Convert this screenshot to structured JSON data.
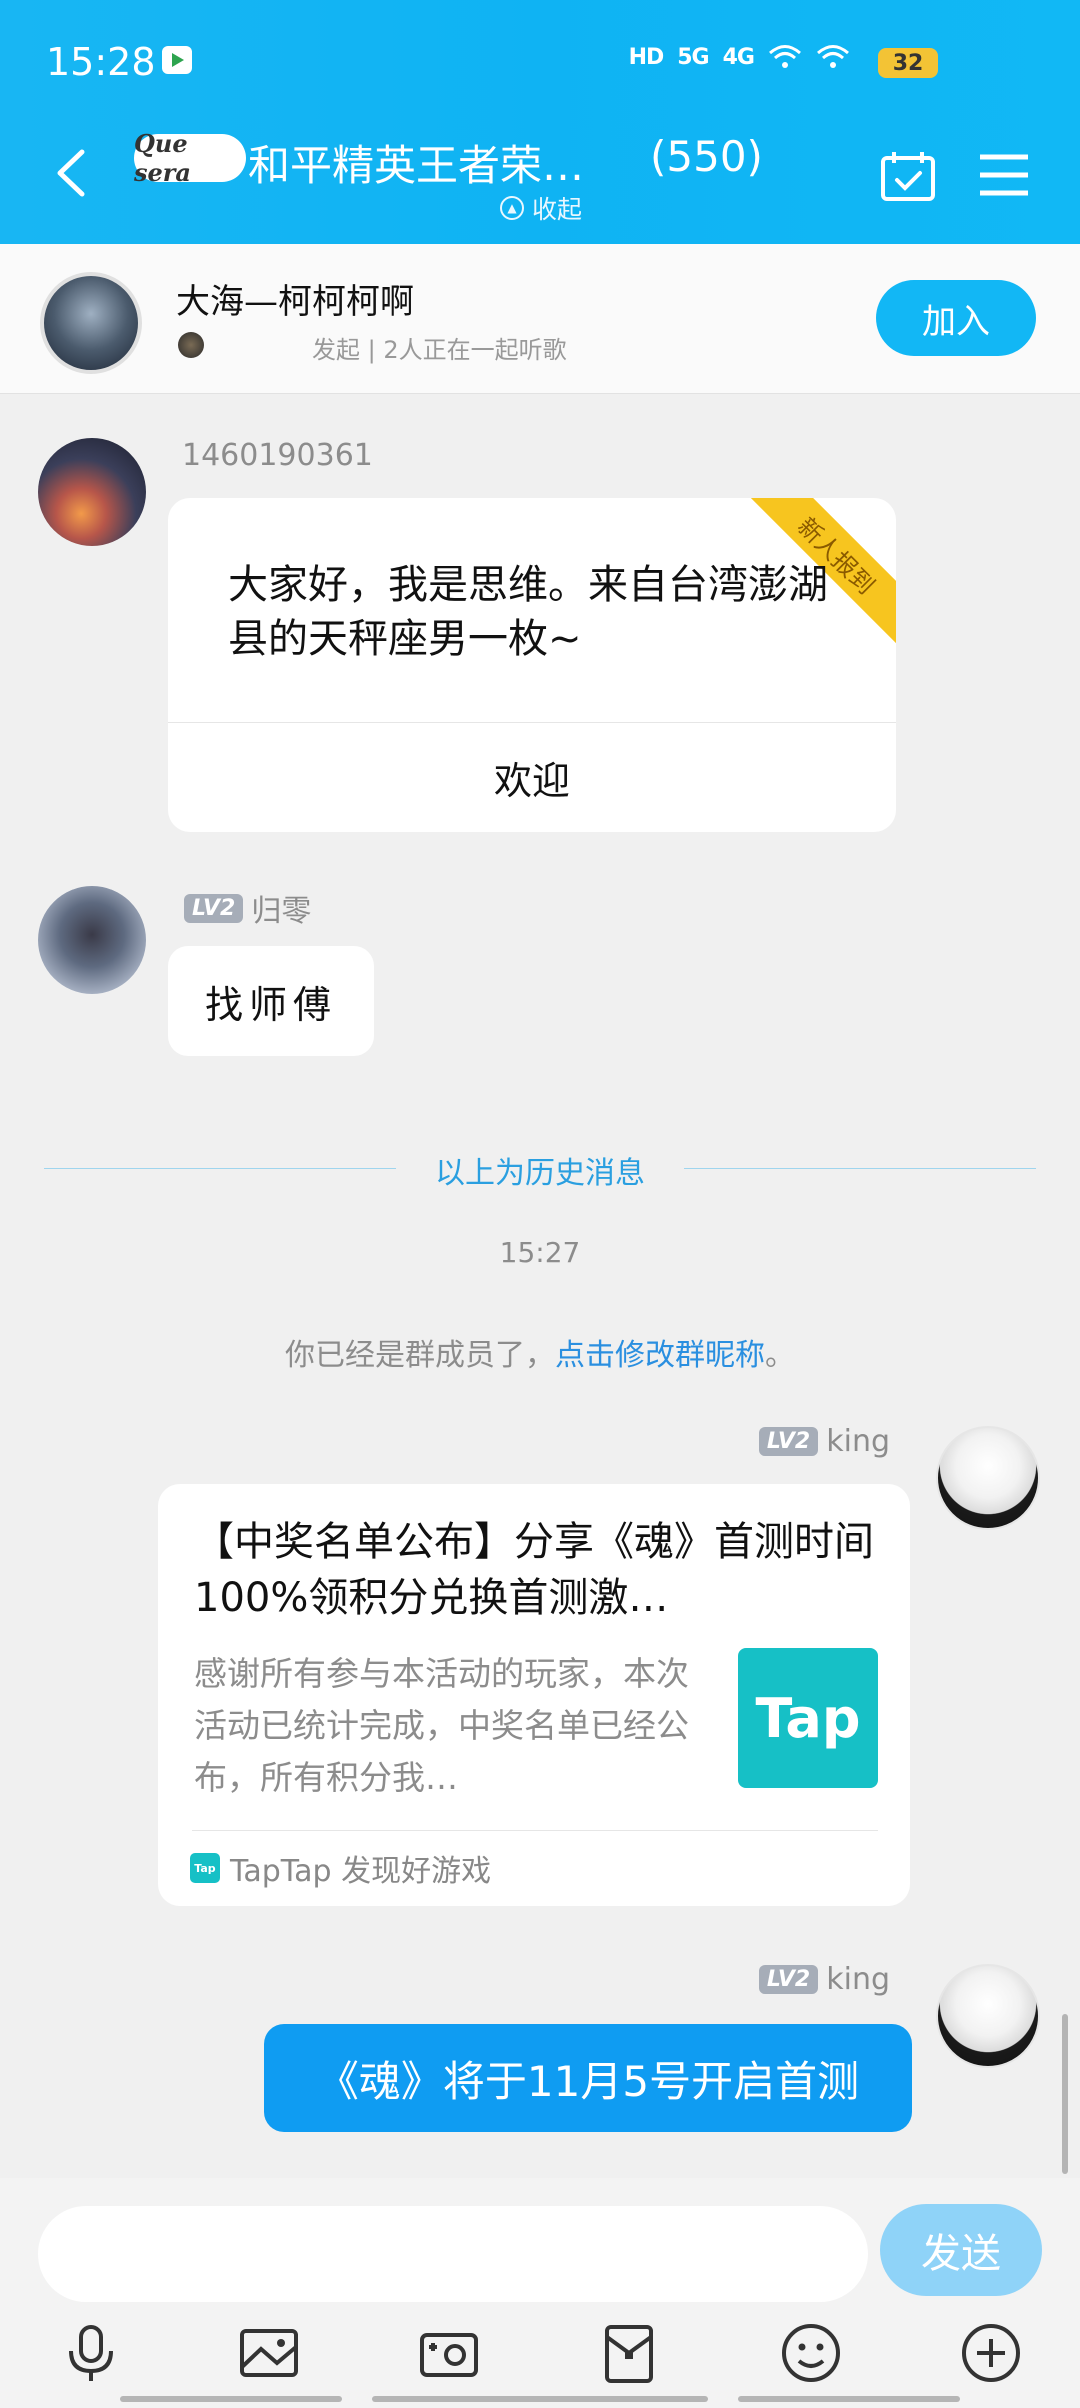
{
  "status_bar": {
    "time": "15:28",
    "signal_labels": [
      "HD",
      "5G",
      "4G"
    ],
    "battery": "32"
  },
  "header": {
    "group_logo_text": "Que sera",
    "group_title": "和平精英王者荣…",
    "member_count": "(550)",
    "collapse_label": "收起"
  },
  "listen_together": {
    "song_title": "大海—柯柯柯啊",
    "subtitle": "发起 | 2人正在一起听歌",
    "join_label": "加入"
  },
  "messages": {
    "m1_sender": "1460190361",
    "m1_ribbon": "新人报到",
    "m1_text": "大家好，我是思维。来自台湾澎湖县的天秤座男一枚~",
    "m1_button": "欢迎",
    "m2_level": "LV2",
    "m2_sender": "归零",
    "m2_text": "找师傅",
    "history_divider": "以上为历史消息",
    "timestamp": "15:27",
    "system_prefix": "你已经是群成员了，",
    "system_link": "点击修改群昵称",
    "system_suffix": "。",
    "m3_level": "LV2",
    "m3_sender": "king",
    "m3_title": "【中奖名单公布】分享《魂》首测时间 100%领积分兑换首测激…",
    "m3_desc": "感谢所有参与本活动的玩家，本次活动已统计完成，中奖名单已经公布，所有积分我…",
    "m3_logo": "Tap",
    "m3_source_icon": "Tap",
    "m3_source": "TapTap 发现好游戏",
    "m4_level": "LV2",
    "m4_sender": "king",
    "m4_text": "《魂》将于11月5号开启首测"
  },
  "input": {
    "value": "",
    "placeholder": "",
    "send_label": "发送"
  },
  "toolbar_icons": [
    "microphone-icon",
    "image-icon",
    "camera-icon",
    "red-packet-icon",
    "emoji-icon",
    "plus-icon"
  ],
  "colors": {
    "header": "#18b6f3",
    "accent": "#12b7f5",
    "outgoing_bubble": "#0f9cf2",
    "link": "#2a8fe0",
    "ribbon": "#f7c51f",
    "taptap": "#16c0c6"
  }
}
